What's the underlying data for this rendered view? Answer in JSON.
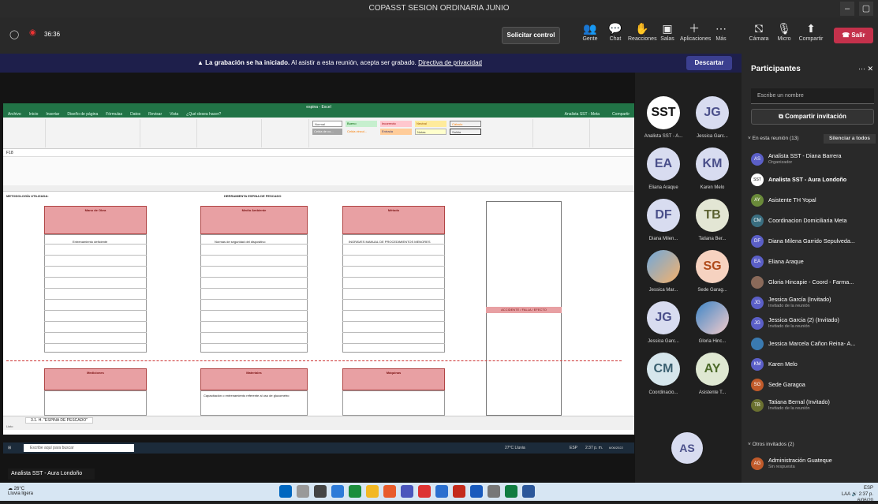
{
  "window": {
    "title": "COPASST SESION ORDINARIA JUNIO"
  },
  "toolbar": {
    "timer": "36:36",
    "request_control": "Solicitar control",
    "items": [
      {
        "label": "Gente",
        "icon": "people-icon"
      },
      {
        "label": "Chat",
        "icon": "chat-icon"
      },
      {
        "label": "Reacciones",
        "icon": "reactions-icon"
      },
      {
        "label": "Salas",
        "icon": "rooms-icon"
      },
      {
        "label": "Aplicaciones",
        "icon": "apps-icon"
      },
      {
        "label": "Más",
        "icon": "more-icon"
      },
      {
        "label": "Cámara",
        "icon": "camera-off-icon"
      },
      {
        "label": "Micro",
        "icon": "mic-icon"
      },
      {
        "label": "Compartir",
        "icon": "share-icon"
      }
    ],
    "leave": "Salir"
  },
  "banner": {
    "bold": "La grabación se ha iniciado.",
    "text": "Al asistir a esta reunión, acepta ser grabado.",
    "link": "Directiva de privacidad",
    "dismiss": "Descartar"
  },
  "excel": {
    "title": "espina - Excel",
    "tabs": [
      "Archivo",
      "Inicio",
      "Insertar",
      "Diseño de página",
      "Fórmulas",
      "Datos",
      "Revisar",
      "Vista",
      "¿Qué desea hacer?"
    ],
    "user": "Analista SST - Meta",
    "share": "Compartir",
    "styles": [
      "Normal",
      "Bueno",
      "Incorrecto",
      "Neutral",
      "Cálculo",
      "Celda de co...",
      "Celda vincul...",
      "Entrada",
      "Notas",
      "Salida"
    ],
    "cell_ref": "F18",
    "labels": {
      "methodology": "METODOLOGÍA UTILIZADA:",
      "tool": "HERRAMIENTA ESPINA DE PESCADO"
    },
    "boxes": [
      {
        "title": "Mano de Obra",
        "entry": "Entrenamiento deficiente"
      },
      {
        "title": "Medio Ambiente",
        "entry": "Normas de seguridad del dispositivo"
      },
      {
        "title": "Método",
        "entry": "INGRAVES MANUAL DE PROCEDIMIENTOS MENORES"
      },
      {
        "title": "Mediciones",
        "entry": ""
      },
      {
        "title": "Materiales",
        "entry": "Capacitación o entrenamiento referente al uso de glucometro"
      },
      {
        "title": "Máquinas",
        "entry": ""
      }
    ],
    "accident_label": "ACCIDENTE / FALLA / EFECTO",
    "sheet_tab": "3.1. H. \"ESPINA DE PESCADO\"",
    "status": "Listo"
  },
  "remote_taskbar": {
    "search": "Escribe aquí para buscar",
    "weather": "27°C Lluvia",
    "time": "2:37 p. m.",
    "date": "6/06/2022",
    "lang": "ESP"
  },
  "presenter_label": "Analista SST - Aura Londoño",
  "tiles": [
    {
      "initials": "SST",
      "name": "Analista SST - A...",
      "color": "#ffffff",
      "fg": "#111"
    },
    {
      "initials": "JG",
      "name": "Jessica Garc...",
      "color": "#d8dcf0",
      "fg": "#4a4f8a"
    },
    {
      "initials": "EA",
      "name": "Eliana Araque",
      "color": "#d8dcf0",
      "fg": "#4a4f8a"
    },
    {
      "initials": "KM",
      "name": "Karen Melo",
      "color": "#d8dcf0",
      "fg": "#4a4f8a"
    },
    {
      "initials": "DF",
      "name": "Diana Milen...",
      "color": "#d8dcf0",
      "fg": "#4a4f8a"
    },
    {
      "initials": "TB",
      "name": "Tatiana Ber...",
      "color": "#e3e6d4",
      "fg": "#5a6030"
    },
    {
      "initials": "",
      "name": "Jessica Mar...",
      "color": "#cfe2f3",
      "fg": "#333"
    },
    {
      "initials": "SG",
      "name": "Sede Garag...",
      "color": "#f6d2c0",
      "fg": "#b04a1a"
    },
    {
      "initials": "JG",
      "name": "Jessica Garc...",
      "color": "#d8dcf0",
      "fg": "#4a4f8a"
    },
    {
      "initials": "",
      "name": "Gloria Hinc...",
      "color": "#cfe2f3",
      "fg": "#333"
    },
    {
      "initials": "CM",
      "name": "Coordinacio...",
      "color": "#d6e6ec",
      "fg": "#3a6070"
    },
    {
      "initials": "AY",
      "name": "Asistente T...",
      "color": "#dfe8d2",
      "fg": "#4d6a2a"
    },
    {
      "initials": "AS",
      "name": "",
      "color": "#d8dcf0",
      "fg": "#4a4f8a"
    }
  ],
  "panel": {
    "title": "Participantes",
    "search_placeholder": "Escribe un nombre",
    "share_invite": "Compartir invitación",
    "in_meeting": "En esta reunión (13)",
    "mute_all": "Silenciar a todos",
    "others": "Otros invitados (2)",
    "participants": [
      {
        "initials": "AS",
        "name": "Analista SST - Diana Barrera",
        "sub": "Organizador",
        "color": "#5b5fc7"
      },
      {
        "initials": "SST",
        "name": "Analista SST - Aura Londoño",
        "sub": "",
        "color": "#ffffff",
        "bold": true
      },
      {
        "initials": "AY",
        "name": "Asistente TH Yopal",
        "sub": "",
        "color": "#6a8a3a"
      },
      {
        "initials": "CM",
        "name": "Coordinacion Domiciliaria Meta",
        "sub": "",
        "color": "#3a6e80"
      },
      {
        "initials": "DF",
        "name": "Diana Milena Garrido Sepulveda...",
        "sub": "",
        "color": "#5b5fc7"
      },
      {
        "initials": "EA",
        "name": "Eliana Araque",
        "sub": "",
        "color": "#5b5fc7"
      },
      {
        "initials": "",
        "name": "Gloria Hincapie - Coord - Farma...",
        "sub": "",
        "color": "#8a6a5a"
      },
      {
        "initials": "JG",
        "name": "Jessica García (Invitado)",
        "sub": "Invitado de la reunión",
        "color": "#5b5fc7"
      },
      {
        "initials": "JG",
        "name": "Jessica Garcia (2) (Invitado)",
        "sub": "Invitado de la reunión",
        "color": "#5b5fc7"
      },
      {
        "initials": "",
        "name": "Jessica Marcela Cañon Reina- A...",
        "sub": "",
        "color": "#3a7ab0"
      },
      {
        "initials": "KM",
        "name": "Karen Melo",
        "sub": "",
        "color": "#5b5fc7"
      },
      {
        "initials": "SG",
        "name": "Sede Garagoa",
        "sub": "",
        "color": "#c05a2a"
      },
      {
        "initials": "TB",
        "name": "Tatiana Bernal (Invitado)",
        "sub": "Invitado de la reunión",
        "color": "#6a7030"
      }
    ],
    "other_participants": [
      {
        "initials": "AG",
        "name": "Administración Guateque",
        "sub": "Sin respuesta",
        "color": "#c05a2a"
      }
    ]
  },
  "win_taskbar": {
    "weather": "26°C",
    "weather_desc": "Lluvia ligera",
    "lang": "ESP\nLAA",
    "time": "2:37 p.",
    "date": "6/06/20"
  }
}
